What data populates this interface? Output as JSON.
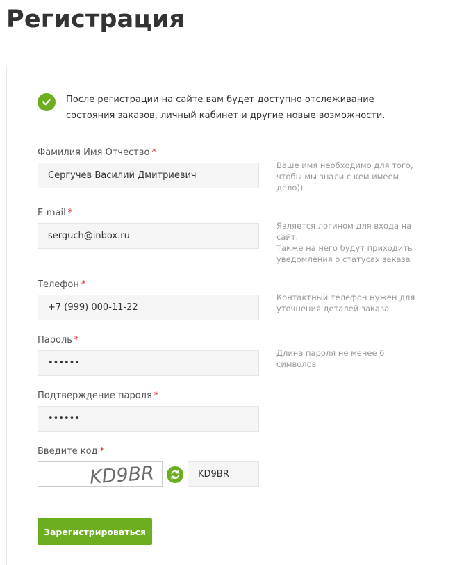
{
  "page": {
    "title": "Регистрация"
  },
  "notice": {
    "icon": "check-circle-icon",
    "text": "После регистрации на сайте вам будет доступно отслеживание состояния заказов, личный кабинет и другие новые возможности."
  },
  "required_mark": "*",
  "fields": {
    "fio": {
      "label": "Фамилия Имя Отчество",
      "value": "Сергучев Василий Дмитриевич",
      "hint": [
        "Ваше имя необходимо для того, чтобы мы знали с кем имеем дело))"
      ]
    },
    "email": {
      "label": "E-mail",
      "value": "serguch@inbox.ru",
      "hint": [
        "Является логином для входа на сайт.",
        "Также на него будут приходить уведомления о статусах заказа"
      ]
    },
    "phone": {
      "label": "Телефон",
      "value": "+7 (999) 000-11-22",
      "hint": [
        "Контактный телефон нужен для уточнения деталей заказа"
      ]
    },
    "password": {
      "label": "Пароль",
      "value": "••••••",
      "hint": [
        "Длина пароля не менее 6 символов"
      ]
    },
    "password_confirm": {
      "label": "Подтверждение пароля",
      "value": "••••••"
    },
    "captcha": {
      "label": "Введите код",
      "image_text": "KD9BR",
      "value": "KD9BR",
      "refresh_icon": "refresh-icon"
    }
  },
  "submit": {
    "label": "Зарегистрироваться"
  },
  "colors": {
    "accent": "#6cae1f",
    "required": "#d9252a",
    "input_bg": "#f5f5f5",
    "hint": "#999999"
  }
}
